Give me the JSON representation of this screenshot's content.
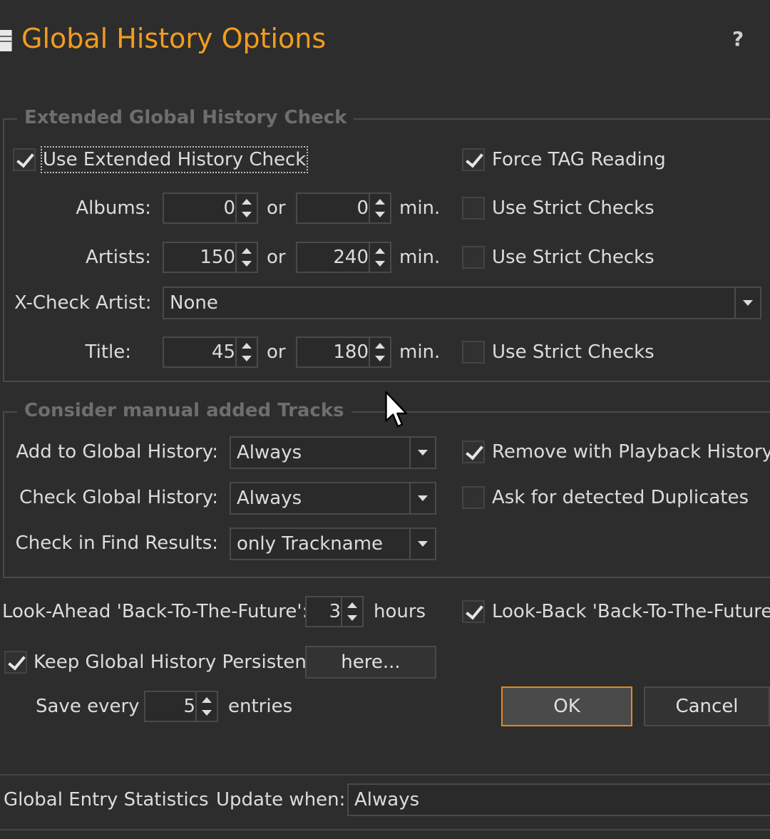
{
  "window": {
    "title": "Global History Options",
    "help_label": "?"
  },
  "extended_group": {
    "legend": "Extended Global History Check",
    "use_extended": {
      "label": "Use Extended History Check",
      "checked": true
    },
    "force_tag": {
      "label": "Force TAG Reading",
      "checked": true
    },
    "or_label": "or",
    "min_label": "min.",
    "albums": {
      "label": "Albums:",
      "value1": "0",
      "value2": "0",
      "strict_label": "Use Strict Checks",
      "strict": false
    },
    "artists": {
      "label": "Artists:",
      "value1": "150",
      "value2": "240",
      "strict_label": "Use Strict Checks",
      "strict": false
    },
    "xcheck": {
      "label": "X-Check Artist:",
      "value": "None"
    },
    "title": {
      "label": "Title:",
      "value1": "45",
      "value2": "180",
      "strict_label": "Use Strict Checks",
      "strict": false
    }
  },
  "manual_group": {
    "legend": "Consider manual added Tracks",
    "add_to_history": {
      "label": "Add to Global History:",
      "value": "Always"
    },
    "check_history": {
      "label": "Check Global History:",
      "value": "Always"
    },
    "check_find": {
      "label": "Check in Find Results:",
      "value": "only Trackname"
    },
    "remove_with_playback": {
      "label": "Remove with Playback History",
      "checked": true
    },
    "ask_duplicates": {
      "label": "Ask for detected Duplicates",
      "checked": false
    }
  },
  "lookahead": {
    "label": "Look-Ahead 'Back-To-The-Future':",
    "value": "3",
    "unit": "hours"
  },
  "lookback": {
    "label": "Look-Back 'Back-To-The-Future'",
    "checked": true
  },
  "persistent": {
    "label": "Keep Global History Persistent",
    "checked": true,
    "here_label": "here..."
  },
  "save_every": {
    "label": "Save every",
    "value": "5",
    "unit": "entries"
  },
  "buttons": {
    "ok": "OK",
    "cancel": "Cancel"
  },
  "stats": {
    "label": "Global Entry Statistics",
    "update_label": "Update when:",
    "update_value": "Always"
  }
}
